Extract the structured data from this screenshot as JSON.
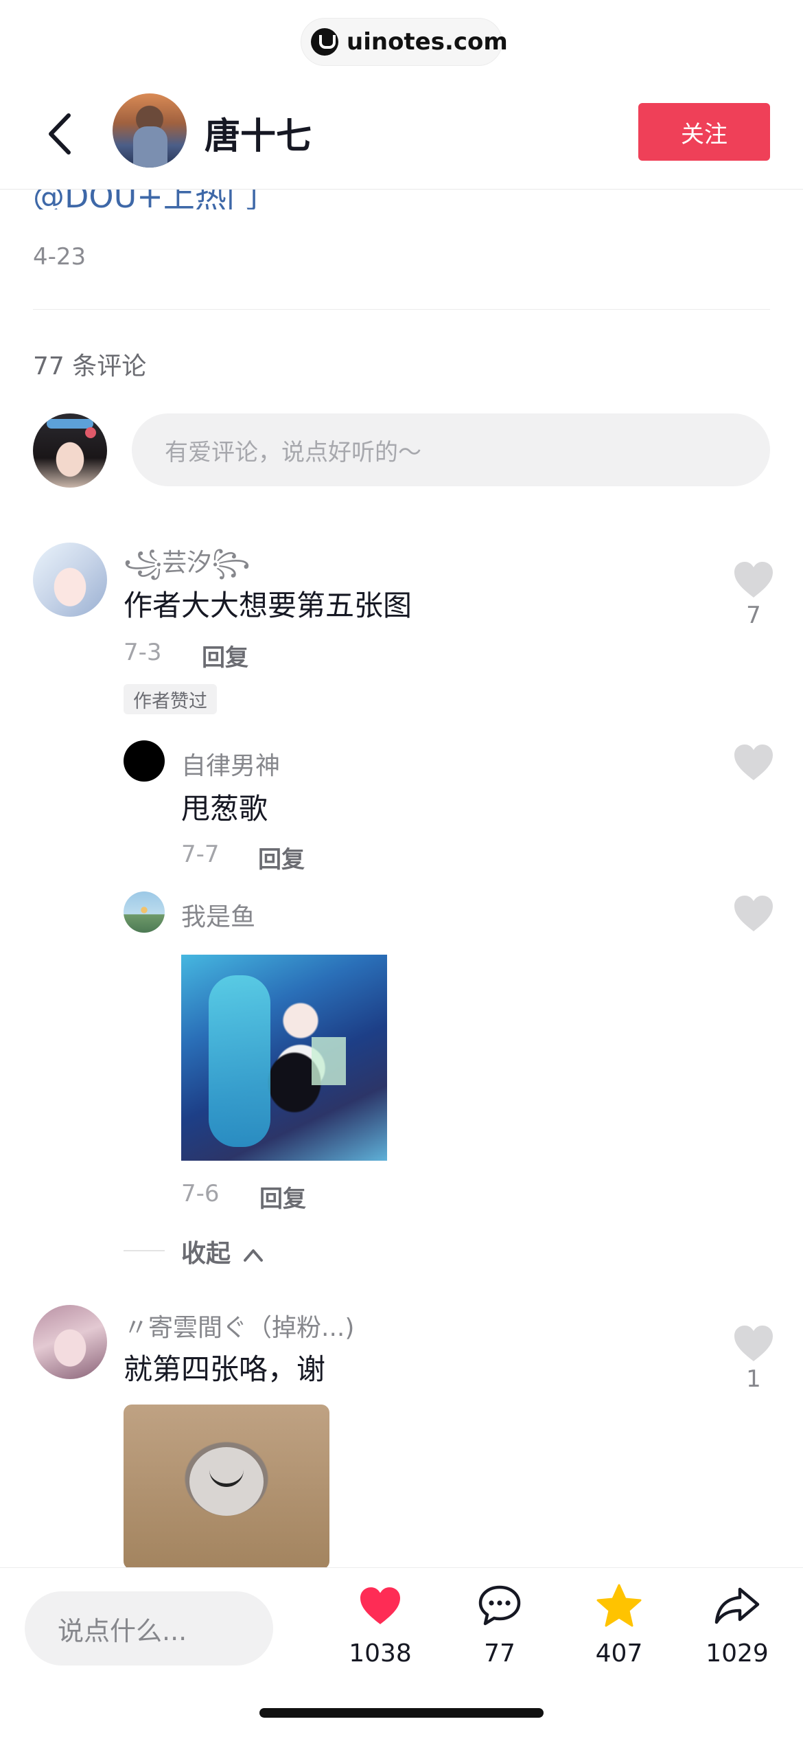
{
  "watermark": {
    "text": "uinotes.com"
  },
  "header": {
    "author_name": "唐十七",
    "follow_label": "关注"
  },
  "post": {
    "tag_text": "@DOU+上热门",
    "date": "4-23"
  },
  "comments_section": {
    "count_label": "77 条评论",
    "input_placeholder": "有爱评论，说点好听的～"
  },
  "comments": [
    {
      "user": "꧁芸汐꧂",
      "text": "作者大大想要第五张图",
      "date": "7-3",
      "reply_label": "回复",
      "badge": "作者赞过",
      "likes": "7",
      "replies": [
        {
          "user": "自律男神",
          "text": "甩葱歌",
          "date": "7-7",
          "reply_label": "回复"
        },
        {
          "user": "我是鱼",
          "date": "7-6",
          "reply_label": "回复"
        }
      ],
      "collapse_label": "收起"
    },
    {
      "user": "〃寄雲間ぐ（掉粉...)",
      "text": "就第四张咯，谢",
      "likes": "1"
    }
  ],
  "bottom_bar": {
    "input_placeholder": "说点什么...",
    "like_count": "1038",
    "comment_count": "77",
    "favorite_count": "407",
    "share_count": "1029"
  },
  "colors": {
    "accent": "#ef4058",
    "like": "#fe2c55",
    "favorite": "#ffc300",
    "link": "#3e68a8"
  }
}
